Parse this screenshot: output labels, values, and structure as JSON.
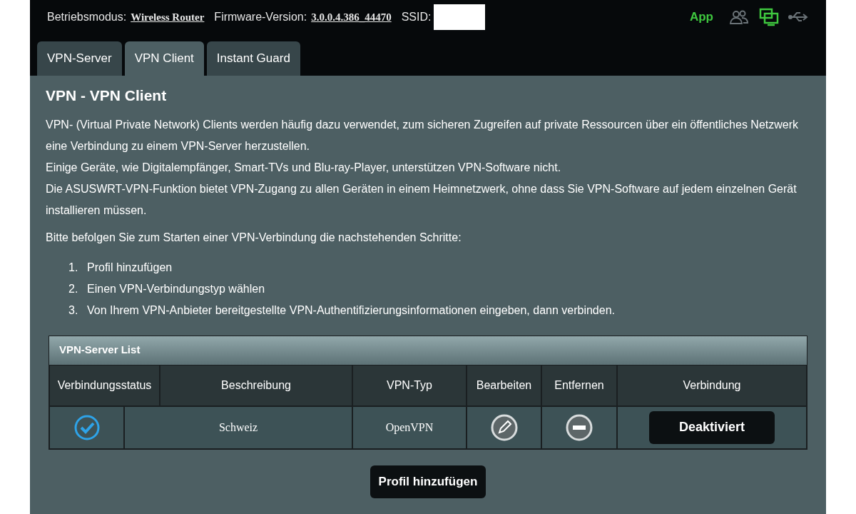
{
  "header": {
    "mode_label": "Betriebsmodus:",
    "mode_value": "Wireless Router",
    "firmware_label": "Firmware-Version:",
    "firmware_value": "3.0.0.4.386_44470",
    "ssid_label": "SSID:",
    "app_label": "App"
  },
  "tabs": [
    {
      "label": "VPN-Server",
      "selected": false
    },
    {
      "label": "VPN Client",
      "selected": true
    },
    {
      "label": "Instant Guard",
      "selected": false
    }
  ],
  "title": "VPN - VPN Client",
  "paragraphs": [
    "VPN- (Virtual Private Network) Clients werden häufig dazu verwendet, zum sicheren Zugreifen auf private Ressourcen über ein öffentliches Netzwerk eine Verbindung zu einem VPN-Server herzustellen.",
    "Einige Geräte, wie Digitalempfänger, Smart-TVs und Blu-ray-Player, unterstützen VPN-Software nicht.",
    "Die ASUSWRT-VPN-Funktion bietet VPN-Zugang zu allen Geräten in einem Heimnetzwerk, ohne dass Sie VPN-Software auf jedem einzelnen Gerät installieren müssen."
  ],
  "intro": "Bitte befolgen Sie zum Starten einer VPN-Verbindung die nachstehenden Schritte:",
  "steps": [
    {
      "number": "1.",
      "text": "Profil hinzufügen"
    },
    {
      "number": "2.",
      "text": "Einen VPN-Verbindungstyp wählen"
    },
    {
      "number": "3.",
      "text": "Von Ihrem VPN-Anbieter bereitgestellte VPN-Authentifizierungsinformationen eingeben, dann verbinden."
    }
  ],
  "table": {
    "title": "VPN-Server List",
    "columns": [
      "Verbindungsstatus",
      "Beschreibung",
      "VPN-Typ",
      "Bearbeiten",
      "Entfernen",
      "Verbindung"
    ],
    "rows": [
      {
        "connected": true,
        "description": "Schweiz",
        "type": "OpenVPN",
        "connection_button": "Deaktiviert"
      }
    ]
  },
  "add_button": "Profil hinzufügen"
}
